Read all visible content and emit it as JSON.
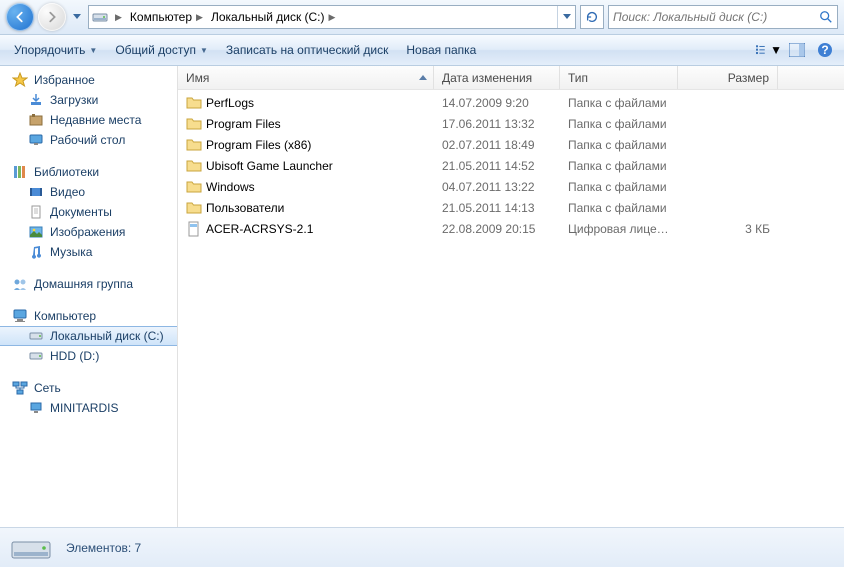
{
  "breadcrumb": {
    "root": "Компьютер",
    "drive": "Локальный диск (C:)"
  },
  "search": {
    "placeholder": "Поиск: Локальный диск (C:)"
  },
  "toolbar": {
    "organize": "Упорядочить",
    "share": "Общий доступ",
    "burn": "Записать на оптический диск",
    "newfolder": "Новая папка"
  },
  "sidebar": {
    "favorites": {
      "label": "Избранное",
      "items": [
        "Загрузки",
        "Недавние места",
        "Рабочий стол"
      ]
    },
    "libraries": {
      "label": "Библиотеки",
      "items": [
        "Видео",
        "Документы",
        "Изображения",
        "Музыка"
      ]
    },
    "homegroup": {
      "label": "Домашняя группа"
    },
    "computer": {
      "label": "Компьютер",
      "items": [
        "Локальный диск (C:)",
        "HDD (D:)"
      ]
    },
    "network": {
      "label": "Сеть",
      "items": [
        "MINITARDIS"
      ]
    }
  },
  "columns": {
    "name": "Имя",
    "date": "Дата изменения",
    "type": "Тип",
    "size": "Размер"
  },
  "rows": [
    {
      "icon": "folder",
      "name": "PerfLogs",
      "date": "14.07.2009 9:20",
      "type": "Папка с файлами",
      "size": ""
    },
    {
      "icon": "folder",
      "name": "Program Files",
      "date": "17.06.2011 13:32",
      "type": "Папка с файлами",
      "size": ""
    },
    {
      "icon": "folder",
      "name": "Program Files (x86)",
      "date": "02.07.2011 18:49",
      "type": "Папка с файлами",
      "size": ""
    },
    {
      "icon": "folder",
      "name": "Ubisoft Game Launcher",
      "date": "21.05.2011 14:52",
      "type": "Папка с файлами",
      "size": ""
    },
    {
      "icon": "folder",
      "name": "Windows",
      "date": "04.07.2011 13:22",
      "type": "Папка с файлами",
      "size": ""
    },
    {
      "icon": "folder",
      "name": "Пользователи",
      "date": "21.05.2011 14:13",
      "type": "Папка с файлами",
      "size": ""
    },
    {
      "icon": "file",
      "name": "ACER-ACRSYS-2.1",
      "date": "22.08.2009 20:15",
      "type": "Цифровая лицен...",
      "size": "3 КБ"
    }
  ],
  "status": {
    "count_label": "Элементов: 7"
  }
}
